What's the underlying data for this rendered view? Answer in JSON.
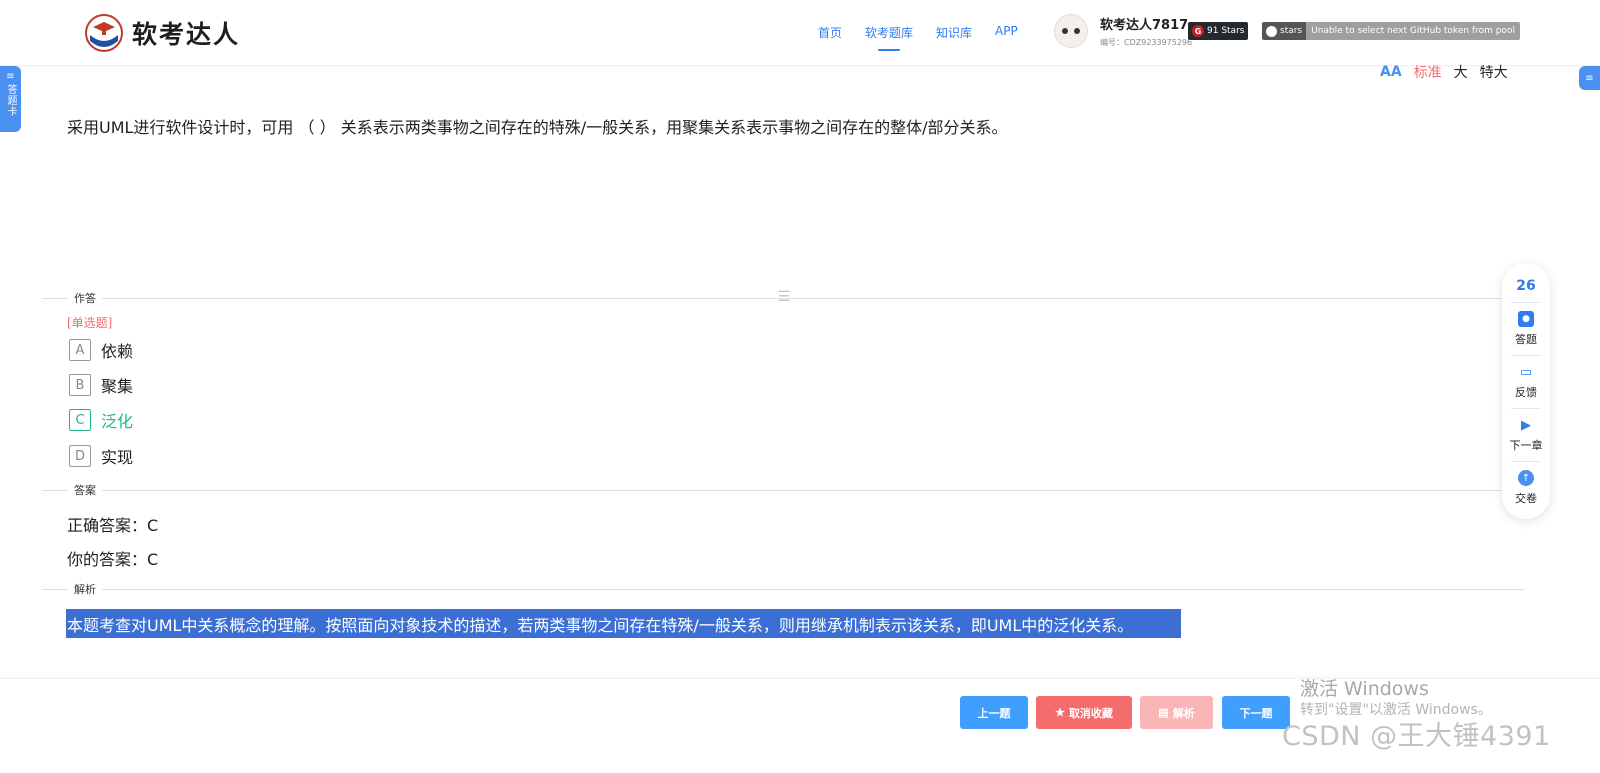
{
  "header": {
    "brand": "软考达人",
    "nav": [
      {
        "label": "首页",
        "active": false
      },
      {
        "label": "软考题库",
        "active": true
      },
      {
        "label": "知识库",
        "active": false
      },
      {
        "label": "APP",
        "active": false
      }
    ],
    "user": {
      "name": "软考达人7817",
      "id": "编号：CDZ9233975296"
    },
    "gitee_badge": {
      "icon": "G",
      "text": "91 Stars"
    },
    "github_badge": {
      "left": "stars",
      "right": "Unable to select next GitHub token from pool"
    }
  },
  "side": {
    "left_tab_label": "答题卡",
    "left_tab_icon": "≡",
    "right_tab_icon": "≡"
  },
  "font_size": {
    "icon": "AA",
    "options": [
      "标准",
      "大",
      "特大"
    ],
    "selected": "标准"
  },
  "question": {
    "text": "采用UML进行软件设计时，可用 （ ） 关系表示两类事物之间存在的特殊/一般关系，用聚集关系表示事物之间存在的整体/部分关系。",
    "section_answer": "作答",
    "type": "[单选题]",
    "options": [
      {
        "letter": "A",
        "text": "依赖",
        "correct": false
      },
      {
        "letter": "B",
        "text": "聚集",
        "correct": false
      },
      {
        "letter": "C",
        "text": "泛化",
        "correct": true
      },
      {
        "letter": "D",
        "text": "实现",
        "correct": false
      }
    ],
    "section_key": "答案",
    "correct_answer": "正确答案：C",
    "your_answer": "你的答案：C",
    "section_explain": "解析",
    "explanation": "本题考查对UML中关系概念的理解。按照面向对象技术的描述，若两类事物之间存在特殊/一般关系，则用继承机制表示该关系，即UML中的泛化关系。"
  },
  "float_panel": {
    "count": "26",
    "items": [
      {
        "icon": "answer-icon",
        "label": "答题"
      },
      {
        "icon": "feedback-icon",
        "label": "反馈"
      },
      {
        "icon": "next-chapter-icon",
        "label": "下一章"
      },
      {
        "icon": "submit-icon",
        "label": "交卷"
      }
    ]
  },
  "buttons": {
    "prev": "上一题",
    "unfavorite": "取消收藏",
    "explain": "解析",
    "next": "下一题"
  },
  "watermarks": {
    "activate_title": "激活 Windows",
    "activate_sub": "转到\"设置\"以激活 Windows。",
    "csdn": "CSDN @王大锤4391"
  },
  "colors": {
    "primary": "#409eff",
    "danger": "#f56c6c",
    "correct": "#25b58a",
    "highlight": "#3b6fd4"
  }
}
